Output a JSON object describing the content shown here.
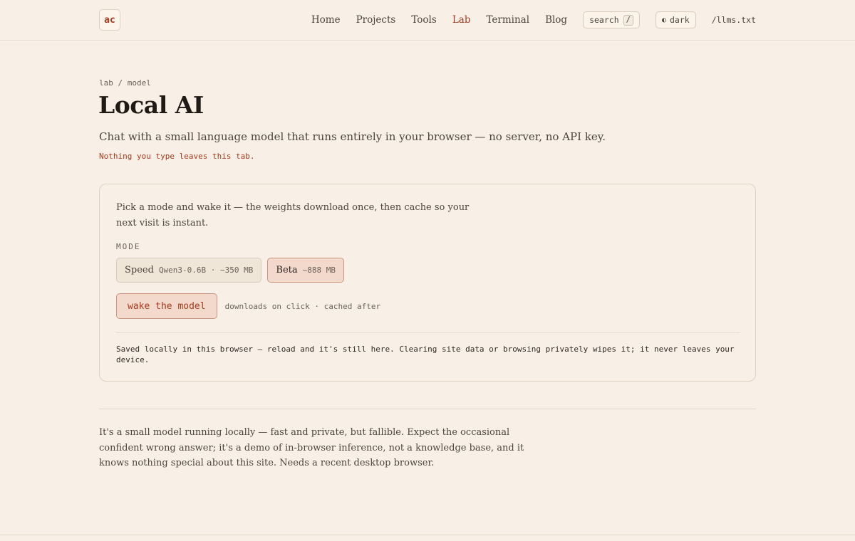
{
  "header": {
    "logo": "ac",
    "nav": {
      "home": "Home",
      "projects": "Projects",
      "tools": "Tools",
      "lab": "Lab",
      "terminal": "Terminal",
      "blog": "Blog"
    },
    "active_nav": "Lab",
    "search_label": "search",
    "search_key": "/",
    "theme_icon": "◐",
    "theme_label": "dark",
    "llms_link": "/llms.txt"
  },
  "page": {
    "breadcrumb": "lab / model",
    "title": "Local AI",
    "subtitle": "Chat with a small language model that runs entirely in your browser — no server, no API key.",
    "privacy_note": "Nothing you type leaves this tab."
  },
  "card": {
    "intro": "Pick a mode and wake it — the weights download once, then cache so your next visit is instant.",
    "mode_label": "MODE",
    "modes": [
      {
        "name": "Speed",
        "detail": "Qwen3-0.6B · ~350 MB",
        "selected": false
      },
      {
        "name": "Beta",
        "detail": "~888 MB",
        "selected": true
      }
    ],
    "wake_button": "wake the model",
    "wake_hint": "downloads on click · cached after",
    "storage_note": "Saved locally in this browser — reload and it's still here. Clearing site data or browsing privately wipes it; it never leaves your device."
  },
  "footer": {
    "disclaimer": "It's a small model running locally — fast and private, but fallible. Expect the occasional confident wrong answer; it's a demo of in-browser inference, not a knowledge base, and it knows nothing special about this site. Needs a recent desktop browser."
  },
  "colors": {
    "background": "#f8f0e6",
    "accent": "#a63a1e",
    "selected_bg": "#f2d9cb"
  }
}
